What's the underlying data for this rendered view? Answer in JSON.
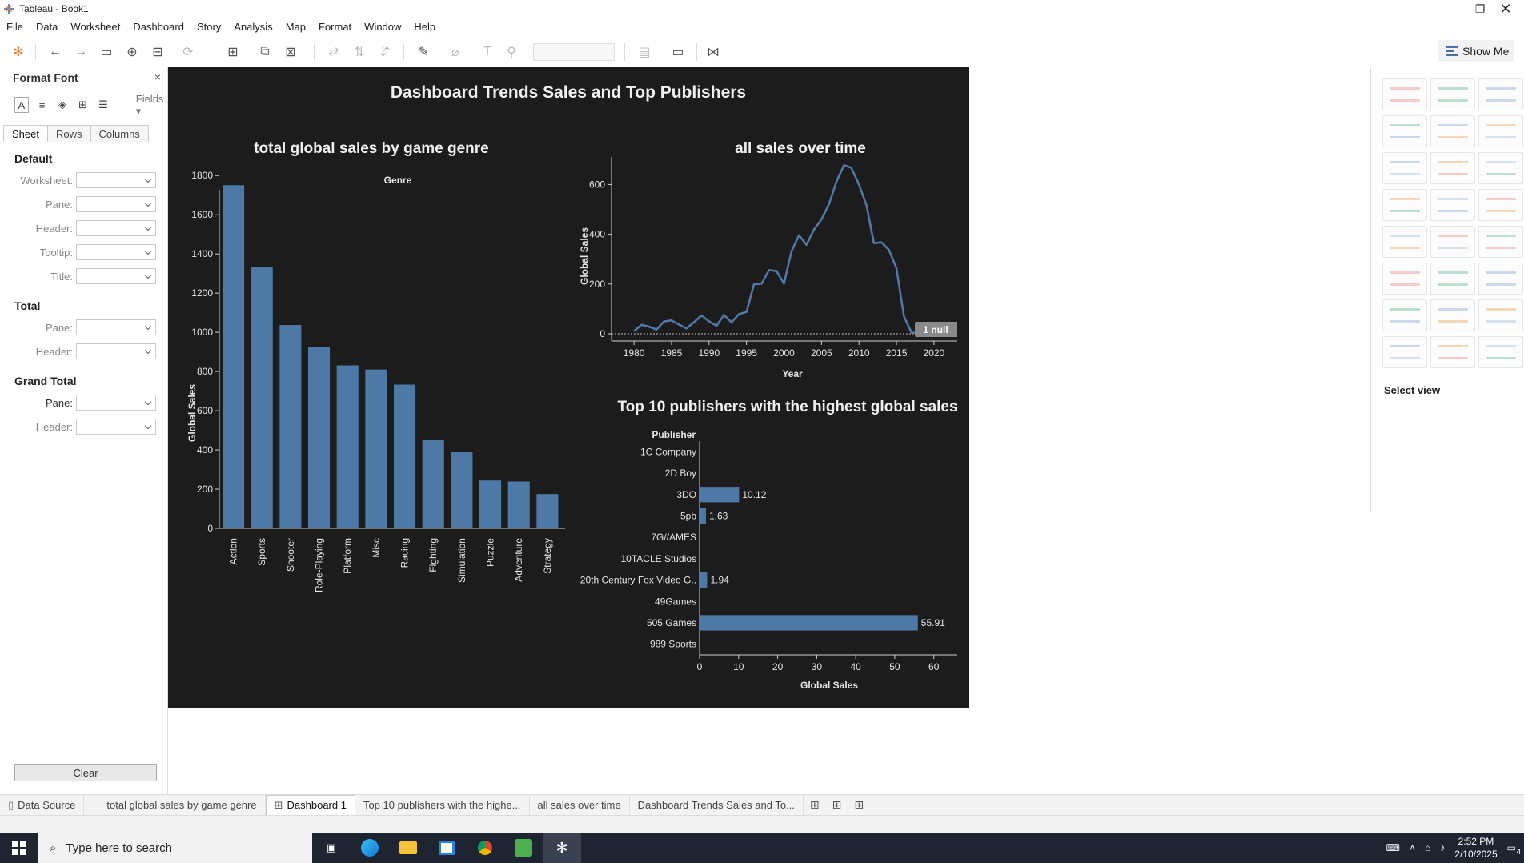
{
  "window": {
    "title": "Tableau - Book1"
  },
  "menu": [
    "File",
    "Data",
    "Worksheet",
    "Dashboard",
    "Story",
    "Analysis",
    "Map",
    "Format",
    "Window",
    "Help"
  ],
  "toolbar": {
    "show_me": "Show Me"
  },
  "format_pane": {
    "title": "Format Font",
    "close": "×",
    "fields_label": "Fields ▾",
    "tabs": [
      "Sheet",
      "Rows",
      "Columns"
    ],
    "sections": [
      {
        "title": "Default",
        "rows": [
          "Worksheet:",
          "Pane:",
          "Header:",
          "Tooltip:",
          "Title:"
        ]
      },
      {
        "title": "Total",
        "rows": [
          "Pane:",
          "Header:"
        ]
      },
      {
        "title": "Grand Total",
        "rows": [
          "Pane:",
          "Header:"
        ]
      }
    ],
    "clear_label": "Clear"
  },
  "dashboard": {
    "title": "Dashboard Trends Sales and Top Publishers",
    "null_badge": "1 null"
  },
  "chart_data": [
    {
      "type": "bar",
      "title": "total global sales by game genre",
      "column_header": "Genre",
      "ylabel": "Global Sales",
      "ylim": [
        0,
        1850
      ],
      "yticks": [
        0,
        200,
        400,
        600,
        800,
        1000,
        1200,
        1400,
        1600,
        1800
      ],
      "categories": [
        "Action",
        "Sports",
        "Shooter",
        "Role-Playing",
        "Platform",
        "Misc",
        "Racing",
        "Fighting",
        "Simulation",
        "Puzzle",
        "Adventure",
        "Strategy"
      ],
      "values": [
        1751,
        1331,
        1037,
        927,
        831,
        810,
        733,
        449,
        392,
        244,
        239,
        175
      ],
      "color": "#4e79a7"
    },
    {
      "type": "line",
      "title": "all sales over time",
      "xlabel": "Year",
      "ylabel": "Global Sales",
      "xlim": [
        1977,
        2023
      ],
      "ylim": [
        0,
        730
      ],
      "xticks": [
        1980,
        1985,
        1990,
        1995,
        2000,
        2005,
        2010,
        2015,
        2020
      ],
      "yticks": [
        0,
        200,
        400,
        600
      ],
      "x": [
        1980,
        1981,
        1982,
        1983,
        1984,
        1985,
        1986,
        1987,
        1988,
        1989,
        1990,
        1991,
        1992,
        1993,
        1994,
        1995,
        1996,
        1997,
        1998,
        1999,
        2000,
        2001,
        2002,
        2003,
        2004,
        2005,
        2006,
        2007,
        2008,
        2009,
        2010,
        2011,
        2012,
        2013,
        2014,
        2015,
        2016,
        2017,
        2020
      ],
      "y": [
        11,
        36,
        29,
        17,
        50,
        54,
        37,
        22,
        47,
        74,
        50,
        32,
        76,
        46,
        79,
        88,
        199,
        201,
        256,
        252,
        202,
        332,
        396,
        358,
        419,
        460,
        521,
        612,
        678,
        667,
        600,
        516,
        364,
        368,
        337,
        264,
        70,
        5,
        0.3
      ],
      "color": "#4e79a7"
    },
    {
      "type": "bar",
      "orientation": "horizontal",
      "title": "Top 10 publishers with the highest global sales",
      "row_header": "Publisher",
      "xlabel": "Global Sales",
      "xlim": [
        0,
        66
      ],
      "xticks": [
        0,
        10,
        20,
        30,
        40,
        50,
        60
      ],
      "categories": [
        "1C Company",
        "2D Boy",
        "3DO",
        "5pb",
        "7G//AMES",
        "10TACLE Studios",
        "20th Century Fox Video G..",
        "49Games",
        "505 Games",
        "989 Sports"
      ],
      "values": [
        0,
        0,
        10.12,
        1.63,
        0,
        0,
        1.94,
        0,
        55.91,
        0
      ],
      "labels": [
        "",
        "",
        "10.12",
        "1.63",
        "",
        "",
        "1.94",
        "",
        "55.91",
        ""
      ],
      "color": "#4e79a7"
    }
  ],
  "show_me_pane": {
    "select_view": "Select view"
  },
  "sheet_tabs": [
    "Data Source",
    "total global sales by game genre",
    "Dashboard 1",
    "Top 10 publishers with the highe...",
    "all sales over time",
    "Dashboard Trends Sales and To..."
  ],
  "taskbar": {
    "search_placeholder": "Type here to search",
    "time": "2:52 PM",
    "date": "2/10/2025",
    "notifications": "4"
  }
}
